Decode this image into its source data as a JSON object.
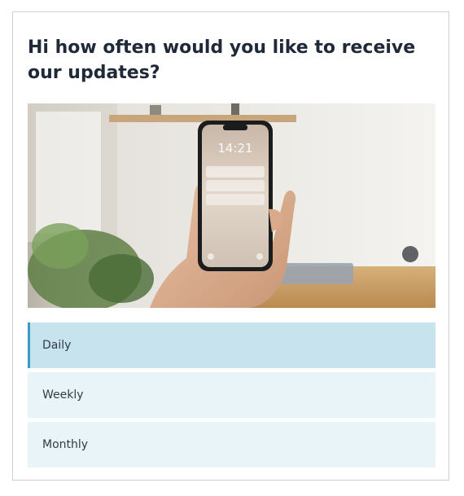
{
  "question": "Hi how often would you like to receive our updates?",
  "image": {
    "subject": "photo-hand-holding-smartphone-icon",
    "phone_time": "14:21"
  },
  "options": [
    {
      "label": "Daily",
      "selected": true
    },
    {
      "label": "Weekly",
      "selected": false
    },
    {
      "label": "Monthly",
      "selected": false
    }
  ],
  "colors": {
    "selected_background": "#c6e3ee",
    "selected_accent": "#3a9cc4",
    "option_background": "#e9f4f9",
    "text": "#1f2937"
  }
}
